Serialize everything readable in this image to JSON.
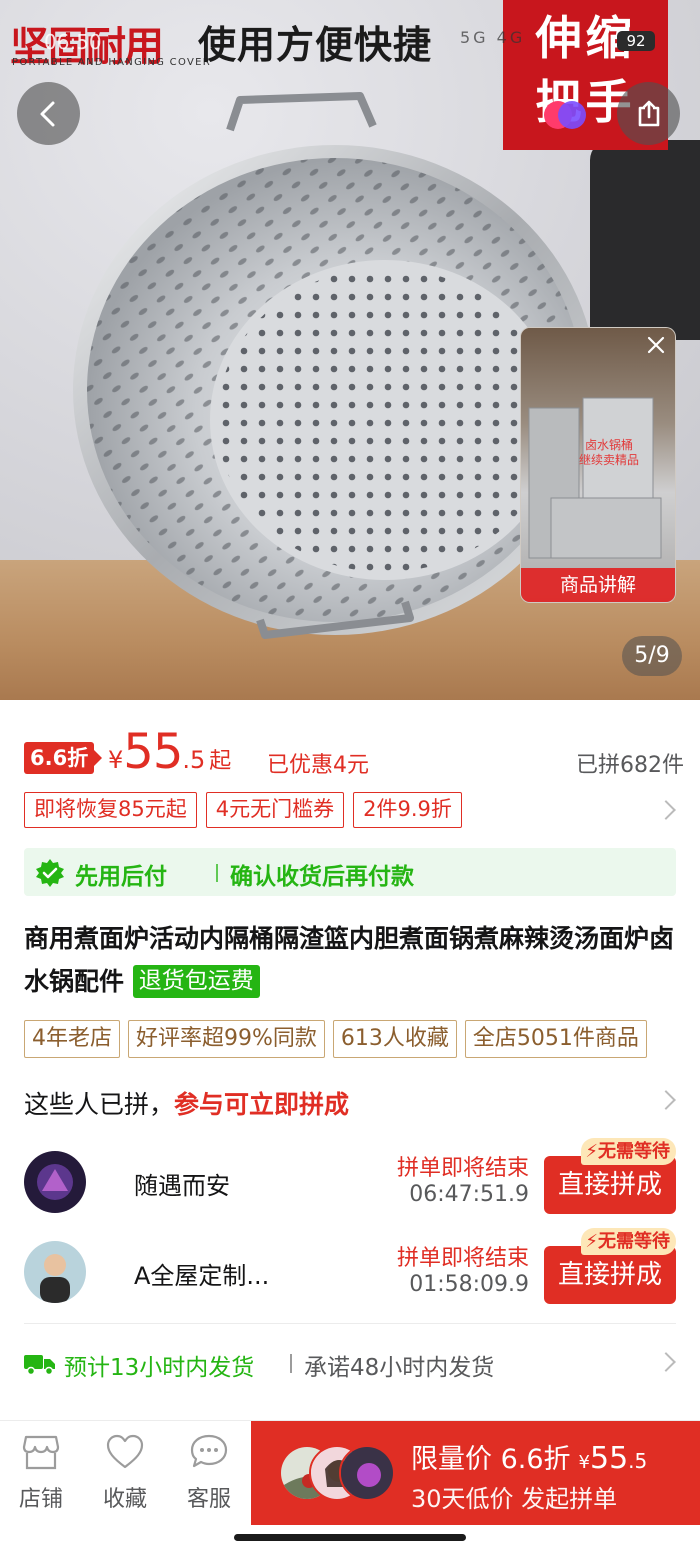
{
  "banner": {
    "brand_title": "坚固耐用",
    "brand_subtitle": "PORTABLE AND HANGING COVER",
    "headline": "使用方便快捷",
    "corner_line1": "伸缩",
    "corner_line2": "把手"
  },
  "status_bar": {
    "time": "06:50",
    "battery": "92",
    "network": "5G 4G"
  },
  "gallery": {
    "counter": "5/9"
  },
  "video_card": {
    "caption": "商品讲解",
    "overlay_text": "卤水锅桶 继续卖精品"
  },
  "price": {
    "discount_badge": "6.6折",
    "currency": "¥",
    "integer": "55",
    "decimal": ".5",
    "suffix": "起",
    "saved": "已优惠4元",
    "sold": "已拼682件"
  },
  "coupons": [
    "即将恢复85元起",
    "4元无门槛券",
    "2件9.9折"
  ],
  "pay_later": {
    "label": "先用后付",
    "desc": "确认收货后再付款"
  },
  "product": {
    "title": "商用煮面炉活动内隔桶隔渣篮内胆煮面锅煮麻辣烫汤面炉卤水锅配件",
    "return_tag": "退货包运费"
  },
  "shop_tags": [
    "4年老店",
    "好评率超99%同款",
    "613人收藏",
    "全店5051件商品"
  ],
  "group_buy": {
    "head_text": "这些人已拼，",
    "head_highlight": "参与可立即拼成",
    "rows": [
      {
        "name": "随遇而安",
        "status": "拼单即将结束",
        "timer": "06:47:51.9",
        "button": "直接拼成",
        "tag": "无需等待"
      },
      {
        "name": "A全屋定制...",
        "status": "拼单即将结束",
        "timer": "01:58:09.9",
        "button": "直接拼成",
        "tag": "无需等待"
      }
    ]
  },
  "shipping": {
    "estimate": "预计13小时内发货",
    "promise": "承诺48小时内发货"
  },
  "bottom_bar": {
    "shop": "店铺",
    "favorite": "收藏",
    "service": "客服",
    "buy_line1_prefix": "限量价 6.6折",
    "buy_currency": "¥",
    "buy_price_int": "55",
    "buy_price_dec": ".5",
    "buy_line2": "30天低价 发起拼单"
  },
  "colors": {
    "accent_red": "#e02e24",
    "green": "#25b513",
    "gold_border": "#c9a774"
  }
}
